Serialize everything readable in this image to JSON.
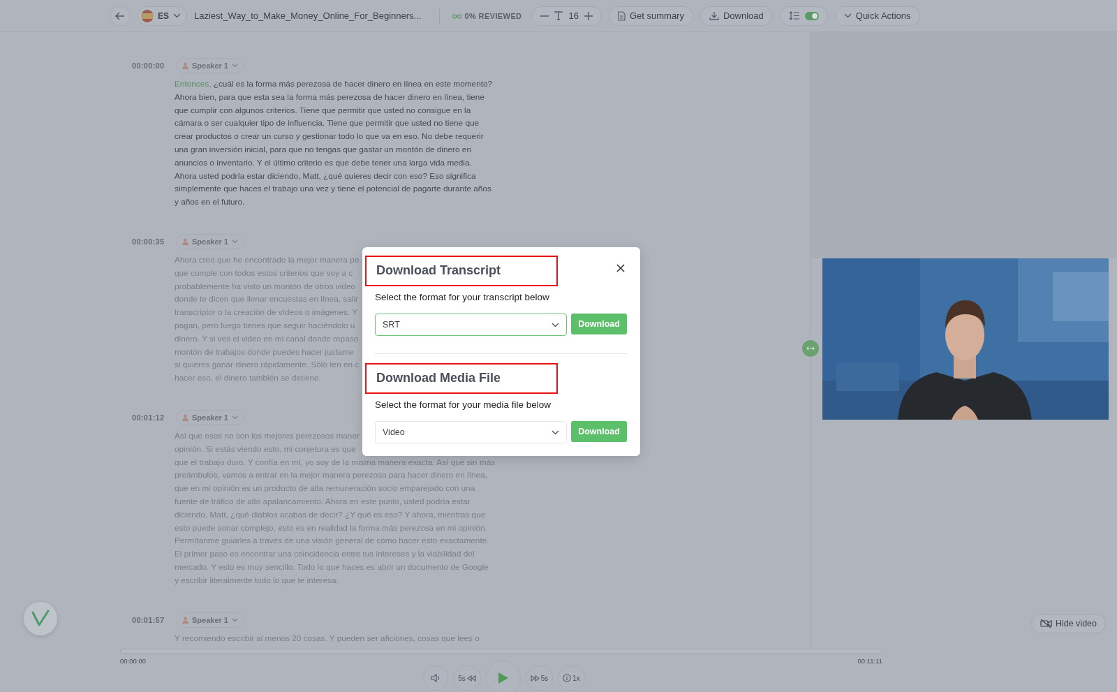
{
  "toolbar": {
    "language": "ES",
    "file_title": "Laziest_Way_to_Make_Money_Online_For_Beginners...",
    "review_status": "0% REVIEWED",
    "font_size": "16",
    "get_summary": "Get summary",
    "download": "Download",
    "line_toggle": {
      "on": true
    },
    "quick_actions": "Quick Actions"
  },
  "segments": [
    {
      "time": "00:00:00",
      "speaker": "Speaker 1",
      "active": true,
      "highlight": "Entonces,",
      "text": " ¿cuál es la forma más perezosa de hacer dinero en línea en este momento? Ahora bien, para que esta sea la forma más perezosa de hacer dinero en línea, tiene que cumplir con algunos criterios. Tiene que permitir que usted no consigue en la cámara o ser cualquier tipo de influencia. Tiene que permitir que usted no tiene que crear productos o crear un curso y gestionar todo lo que va en eso. No debe requerir una gran inversión inicial, para que no tengas que gastar un montón de dinero en anuncios o inventario. Y el último criterio es que debe tener una larga vida media. Ahora usted podría estar diciendo, Matt, ¿qué quieres decir con eso? Eso significa simplemente que haces el trabajo una vez y tiene el potencial de pagarte durante años y años en el futuro."
    },
    {
      "time": "00:00:35",
      "speaker": "Speaker 1",
      "active": false,
      "lines": [
        "Ahora creo que he encontrado la mejor manera pe",
        "que cumple con todos estos criterios que voy a c",
        "probablemente ha visto un montón de otros video",
        "donde te dicen que llenar encuestas en línea, salir",
        "transcriptor o la creación de vídeos o imágenes. Y",
        "pagan, pero luego tienes que seguir haciéndolo u",
        "dinero. Y si ves el video en mi canal donde repaso",
        "montón de trabajos donde puedes hacer justame",
        "si quieres ganar dinero rápidamente. Sólo ten en c",
        "hacer eso, el dinero también se detiene."
      ]
    },
    {
      "time": "00:01:12",
      "speaker": "Speaker 1",
      "active": false,
      "lines": [
        "Así que esos no son los mejores perezosos maner",
        "opinión. Si estás viendo esto, mi conjetura es que",
        "que el trabajo duro. Y confía en mí, yo soy de la misma manera exacta. Así que sin más",
        "preámbulos, vamos a entrar en la mejor manera perezoso para hacer dinero en línea,",
        "que en mi opinión es un producto de alta remuneración socio emparejado con una",
        "fuente de tráfico de alto apalancamiento. Ahora en este punto, usted podría estar",
        "diciendo, Matt, ¿qué diablos acabas de decir? ¿Y qué es eso? Y ahora, mientras que",
        "esto puede sonar complejo, esto es en realidad la forma más perezosa en mi opinión.",
        "Permítanme guiarles a través de una visión general de cómo hacer esto exactamente.",
        "El primer paso es encontrar una coincidencia entre tus intereses y la viabilidad del",
        "mercado. Y esto es muy sencillo. Todo lo que haces es abrir un documento de Google",
        "y escribir literalmente todo lo que te interesa."
      ]
    },
    {
      "time": "00:01:57",
      "speaker": "Speaker 1",
      "active": false,
      "lines": [
        "Y recomiendo escribir al menos 20 cosas. Y pueden ser aficiones, cosas que lees o"
      ]
    }
  ],
  "video": {
    "kind": "picture",
    "hide_button": "Hide video"
  },
  "player": {
    "current_time": "00:00:00",
    "total_time": "00:11:11",
    "level": 0,
    "rewind": "5s",
    "forward": "5s",
    "speed": "1x"
  },
  "modal": {
    "sections": [
      {
        "title": "Download Transcript",
        "highlighted": true,
        "subtitle": "Select the format for your transcript below",
        "value": "SRT",
        "focused": true,
        "button": "Download"
      },
      {
        "title": "Download Media File",
        "highlighted": true,
        "subtitle": "Select the format for your media file below",
        "value": "Video",
        "focused": false,
        "button": "Download"
      }
    ]
  }
}
